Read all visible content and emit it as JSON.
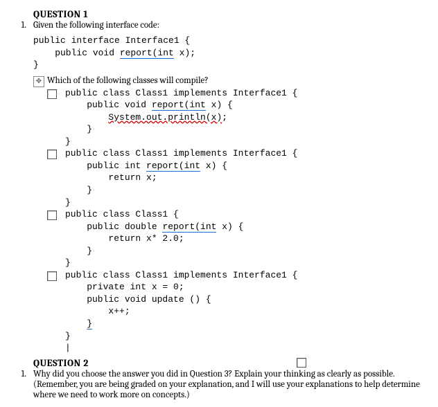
{
  "q1": {
    "header": "QUESTION 1",
    "list_num": "1.",
    "prompt": "Given the following interface code:",
    "code_line1": "public interface Interface1 {",
    "code_line2_a": "    public void ",
    "code_line2_b": "report(int",
    "code_line2_c": " x);",
    "code_line3": "}",
    "subq_handle": "✥",
    "subq_text": "Which of the following classes will compile?",
    "options": [
      {
        "l1": "public class Class1 implements Interface1 {",
        "l2a": "    public void ",
        "l2b": "report(int",
        "l2c": " x) {",
        "l3a": "        ",
        "l3b": "System.out.println(x)",
        "l3c": ";",
        "l4": "    }",
        "l5": "}"
      },
      {
        "l1": "public class Class1 implements Interface1 {",
        "l2a": "    public int ",
        "l2b": "report(int",
        "l2c": " x) {",
        "l3": "        return x;",
        "l4": "    }",
        "l5": "}"
      },
      {
        "l1": "public class Class1 {",
        "l2a": "    public double ",
        "l2b": "report(int",
        "l2c": " x) {",
        "l3": "        return x* 2.0;",
        "l4": "    }",
        "l5": "}"
      },
      {
        "l1": "public class Class1 implements Interface1 {",
        "l2": "    private int x = 0;",
        "l3": "    public void update () {",
        "l4": "        x++;",
        "l5a": "    ",
        "l5b": "}",
        "l6": "}",
        "cursor": "|"
      }
    ]
  },
  "q2": {
    "header": "QUESTION 2",
    "list_num": "1.",
    "prompt": "Why did you choose the answer you did in Question 3? Explain your thinking as clearly as possible. (Remember, you are being graded on your explanation, and I will use your explanations to help determine where we need to work more on concepts.)"
  }
}
